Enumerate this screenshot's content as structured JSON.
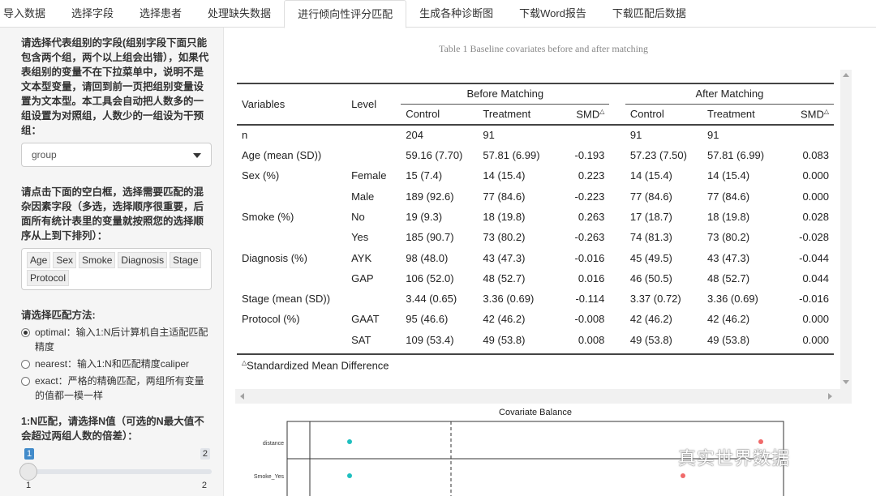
{
  "tabs": [
    {
      "label": "导入数据",
      "active": false
    },
    {
      "label": "选择字段",
      "active": false
    },
    {
      "label": "选择患者",
      "active": false
    },
    {
      "label": "处理缺失数据",
      "active": false
    },
    {
      "label": "进行倾向性评分匹配",
      "active": true
    },
    {
      "label": "生成各种诊断图",
      "active": false
    },
    {
      "label": "下载Word报告",
      "active": false
    },
    {
      "label": "下载匹配后数据",
      "active": false
    }
  ],
  "sidebar": {
    "group_label": "请选择代表组别的字段(组别字段下面只能包含两个组，两个以上组会出错），如果代表组别的变量不在下拉菜单中，说明不是文本型变量，请回到前一页把组别变量设置为文本型。本工具会自动把人数多的一组设置为对照组，人数少的一组设为干预组：",
    "group_value": "group",
    "confounders_label": "请点击下面的空白框，选择需要匹配的混杂因素字段（多选，选择顺序很重要，后面所有统计表里的变量就按照您的选择顺序从上到下排列）：",
    "confounders": [
      "Age",
      "Sex",
      "Smoke",
      "Diagnosis",
      "Stage",
      "Protocol"
    ],
    "method_label": "请选择匹配方法:",
    "methods": [
      {
        "label": "optimal：输入1:N后计算机自主适配匹配精度",
        "checked": true
      },
      {
        "label": "nearest：输入1:N和匹配精度caliper",
        "checked": false
      },
      {
        "label": "exact：严格的精确匹配，两组所有变量的值都一模一样",
        "checked": false
      }
    ],
    "ratio_label": "1:N匹配，请选择N值（可选的N最大值不会超过两组人数的倍差）：",
    "ratio_value": "1",
    "ratio_max_bubble": "2",
    "ratio_min": "1",
    "ratio_max": "2"
  },
  "table": {
    "caption": "Table 1 Baseline covariates before and after matching",
    "col_variables": "Variables",
    "col_level": "Level",
    "group_before": "Before Matching",
    "group_after": "After Matching",
    "sub_control": "Control",
    "sub_treatment": "Treatment",
    "sub_smd": "SMD",
    "smd_mark": "△",
    "rows": [
      {
        "var": "n",
        "level": "",
        "bc": "204",
        "bt": "91",
        "bs": "",
        "ac": "91",
        "at": "91",
        "as": ""
      },
      {
        "var": "Age (mean (SD))",
        "level": "",
        "bc": "59.16 (7.70)",
        "bt": "57.81 (6.99)",
        "bs": "-0.193",
        "ac": "57.23 (7.50)",
        "at": "57.81 (6.99)",
        "as": "0.083"
      },
      {
        "var": "Sex (%)",
        "level": "Female",
        "bc": "15 (7.4)",
        "bt": "14 (15.4)",
        "bs": "0.223",
        "ac": "14 (15.4)",
        "at": "14 (15.4)",
        "as": "0.000"
      },
      {
        "var": "",
        "level": "Male",
        "bc": "189 (92.6)",
        "bt": "77 (84.6)",
        "bs": "-0.223",
        "ac": "77 (84.6)",
        "at": "77 (84.6)",
        "as": "0.000"
      },
      {
        "var": "Smoke (%)",
        "level": "No",
        "bc": "19 (9.3)",
        "bt": "18 (19.8)",
        "bs": "0.263",
        "ac": "17 (18.7)",
        "at": "18 (19.8)",
        "as": "0.028"
      },
      {
        "var": "",
        "level": "Yes",
        "bc": "185 (90.7)",
        "bt": "73 (80.2)",
        "bs": "-0.263",
        "ac": "74 (81.3)",
        "at": "73 (80.2)",
        "as": "-0.028"
      },
      {
        "var": "Diagnosis (%)",
        "level": "AYK",
        "bc": "98 (48.0)",
        "bt": "43 (47.3)",
        "bs": "-0.016",
        "ac": "45 (49.5)",
        "at": "43 (47.3)",
        "as": "-0.044"
      },
      {
        "var": "",
        "level": "GAP",
        "bc": "106 (52.0)",
        "bt": "48 (52.7)",
        "bs": "0.016",
        "ac": "46 (50.5)",
        "at": "48 (52.7)",
        "as": "0.044"
      },
      {
        "var": "Stage (mean (SD))",
        "level": "",
        "bc": "3.44 (0.65)",
        "bt": "3.36 (0.69)",
        "bs": "-0.114",
        "ac": "3.37 (0.72)",
        "at": "3.36 (0.69)",
        "as": "-0.016"
      },
      {
        "var": "Protocol (%)",
        "level": "GAAT",
        "bc": "95 (46.6)",
        "bt": "42 (46.2)",
        "bs": "-0.008",
        "ac": "42 (46.2)",
        "at": "42 (46.2)",
        "as": "0.000"
      },
      {
        "var": "",
        "level": "SAT",
        "bc": "109 (53.4)",
        "bt": "49 (53.8)",
        "bs": "0.008",
        "ac": "49 (53.8)",
        "at": "49 (53.8)",
        "as": "0.000"
      }
    ],
    "footnote": "Standardized Mean Difference"
  },
  "plot": {
    "title": "Covariate Balance",
    "labels": [
      "distance",
      "Smoke_Yes"
    ],
    "unadjusted_color": "#f06a6a",
    "adjusted_color": "#1fbfbf"
  },
  "watermark": "真实世界数据",
  "chart_data": {
    "type": "scatter",
    "title": "Covariate Balance",
    "categories": [
      "distance",
      "Smoke_Yes"
    ],
    "series": []
  }
}
